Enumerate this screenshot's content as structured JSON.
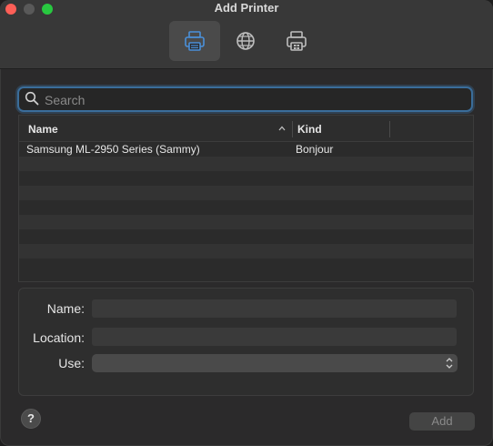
{
  "window": {
    "title": "Add Printer"
  },
  "toolbar": {
    "tabs": [
      {
        "icon": "default-printer-icon",
        "selected": true
      },
      {
        "icon": "ip-globe-icon",
        "selected": false
      },
      {
        "icon": "windows-printer-icon",
        "selected": false
      }
    ]
  },
  "search": {
    "placeholder": "Search",
    "value": ""
  },
  "table": {
    "columns": [
      {
        "label": "Name",
        "sorted": "ascending"
      },
      {
        "label": "Kind"
      }
    ],
    "rows": [
      {
        "name": "Samsung ML-2950 Series (Sammy)",
        "kind": "Bonjour"
      },
      {
        "name": "",
        "kind": ""
      },
      {
        "name": "",
        "kind": ""
      },
      {
        "name": "",
        "kind": ""
      },
      {
        "name": "",
        "kind": ""
      },
      {
        "name": "",
        "kind": ""
      },
      {
        "name": "",
        "kind": ""
      },
      {
        "name": "",
        "kind": ""
      },
      {
        "name": "",
        "kind": ""
      }
    ]
  },
  "details": {
    "name_label": "Name:",
    "name_value": "",
    "location_label": "Location:",
    "location_value": "",
    "use_label": "Use:",
    "use_value": ""
  },
  "footer": {
    "help_label": "?",
    "add_label": "Add"
  },
  "colors": {
    "accent": "#3a6d9a",
    "selected_icon": "#4a90d9"
  }
}
